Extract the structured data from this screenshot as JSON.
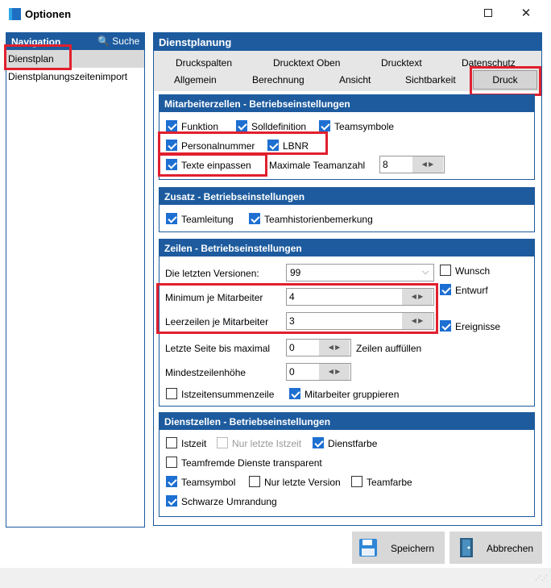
{
  "window": {
    "title": "Optionen",
    "minimize": "—",
    "close": "✕"
  },
  "navigation": {
    "header": "Navigation",
    "search": "🔍 Suche",
    "items": [
      {
        "label": "Dienstplan",
        "selected": true
      },
      {
        "label": "Dienstplanungszeitenimport",
        "selected": false
      }
    ]
  },
  "main": {
    "header": "Dienstplanung",
    "tabs_row1": [
      "Druckspalten",
      "Drucktext Oben",
      "Drucktext",
      "Datenschutz"
    ],
    "tabs_row2": [
      "Allgemein",
      "Berechnung",
      "Ansicht",
      "Sichtbarkeit",
      "Druck"
    ],
    "active_tab": "Druck"
  },
  "mitarbeiterzellen": {
    "header": "Mitarbeiterzellen - Betriebseinstellungen",
    "funktion": {
      "label": "Funktion",
      "checked": true
    },
    "solldefinition": {
      "label": "Solldefinition",
      "checked": true
    },
    "teamsymbole": {
      "label": "Teamsymbole",
      "checked": true
    },
    "personalnummer": {
      "label": "Personalnummer",
      "checked": true
    },
    "lbnr": {
      "label": "LBNR",
      "checked": true
    },
    "texte_einpassen": {
      "label": "Texte einpassen",
      "checked": true
    },
    "max_teamanzahl_label": "Maximale Teamanzahl",
    "max_teamanzahl_value": "8"
  },
  "zusatz": {
    "header": "Zusatz - Betriebseinstellungen",
    "teamleitung": {
      "label": "Teamleitung",
      "checked": true
    },
    "teamhistorienbemerkung": {
      "label": "Teamhistorienbemerkung",
      "checked": true
    }
  },
  "zeilen": {
    "header": "Zeilen - Betriebseinstellungen",
    "letzte_versionen_label": "Die letzten Versionen:",
    "letzte_versionen_value": "99",
    "wunsch": {
      "label": "Wunsch",
      "checked": false
    },
    "entwurf": {
      "label": "Entwurf",
      "checked": true
    },
    "ereignisse": {
      "label": "Ereignisse",
      "checked": true
    },
    "minimum_label": "Minimum je Mitarbeiter",
    "minimum_value": "4",
    "leerzeilen_label": "Leerzeilen je Mitarbeiter",
    "leerzeilen_value": "3",
    "letzte_seite_label": "Letzte Seite bis maximal",
    "letzte_seite_value": "0",
    "zeilen_auffuellen": "Zeilen auffüllen",
    "mindestzeilenhoehe_label": "Mindestzeilenhöhe",
    "mindestzeilenhoehe_value": "0",
    "istzeitensummenzeile": {
      "label": "Istzeitensummenzeile",
      "checked": false
    },
    "mitarbeiter_gruppieren": {
      "label": "Mitarbeiter gruppieren",
      "checked": true
    }
  },
  "dienstzellen": {
    "header": "Dienstzellen - Betriebseinstellungen",
    "istzeit": {
      "label": "Istzeit",
      "checked": false
    },
    "nur_letzte_istzeit": {
      "label": "Nur letzte Istzeit",
      "checked": false,
      "disabled": true
    },
    "dienstfarbe": {
      "label": "Dienstfarbe",
      "checked": true
    },
    "teamfremde": {
      "label": "Teamfremde Dienste transparent",
      "checked": false
    },
    "teamsymbol": {
      "label": "Teamsymbol",
      "checked": true
    },
    "nur_letzte_version": {
      "label": "Nur letzte Version",
      "checked": false
    },
    "teamfarbe": {
      "label": "Teamfarbe",
      "checked": false
    },
    "schwarze_umrandung": {
      "label": "Schwarze Umrandung",
      "checked": true
    }
  },
  "buttons": {
    "save": "Speichern",
    "cancel": "Abbrechen"
  },
  "colors": {
    "accent": "#1d5b9e",
    "highlight": "#e0202e",
    "checkbox": "#1d6fd1"
  }
}
